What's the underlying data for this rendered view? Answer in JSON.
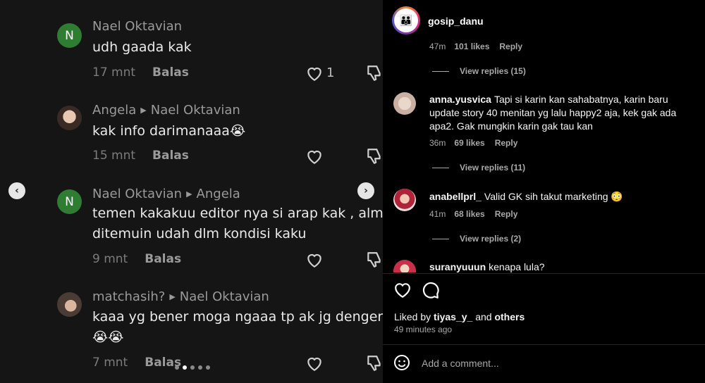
{
  "left": {
    "comments": [
      {
        "avatar_letter": "N",
        "author": "Nael Oktavian",
        "reply_to": "",
        "text": "udh gaada kak",
        "text2": "",
        "time": "17 mnt",
        "reply_label": "Balas",
        "likes": "1"
      },
      {
        "avatar_letter": "",
        "author": "Angela",
        "reply_to": "Nael Oktavian",
        "text": "kak info darimanaaa😭",
        "text2": "",
        "time": "15 mnt",
        "reply_label": "Balas",
        "likes": ""
      },
      {
        "avatar_letter": "N",
        "author": "Nael Oktavian",
        "reply_to": "Angela",
        "text": "temen kakakuu editor nya si arap kak , alm.",
        "text2": "ditemuin udah dlm kondisi kaku",
        "time": "9 mnt",
        "reply_label": "Balas",
        "likes": ""
      },
      {
        "avatar_letter": "",
        "author": "matchasih?",
        "reply_to": "Nael Oktavian",
        "text": "kaaa yg bener moga ngaaa tp ak jg dengerr",
        "text2": "😭😭",
        "time": "7 mnt",
        "reply_label": "Balas",
        "likes": ""
      }
    ],
    "nav_prev": "‹",
    "nav_next": "›"
  },
  "right": {
    "top_user": {
      "username": "gosip_danu",
      "time": "47m",
      "likes": "101 likes",
      "reply": "Reply",
      "view_replies": "View replies (15)"
    },
    "comments": [
      {
        "username": "anna.yusvica",
        "text": "Tapi si karin kan sahabatnya, karin baru update story 40 menitan yg lalu happy2 aja, kek gak ada apa2. Gak mungkin karin gak tau kan",
        "time": "36m",
        "likes": "69 likes",
        "reply": "Reply",
        "view_replies": "View replies (11)"
      },
      {
        "username": "anabellprl_",
        "text": "Valid GK sih takut marketing 😳",
        "time": "41m",
        "likes": "68 likes",
        "reply": "Reply",
        "view_replies": "View replies (2)"
      },
      {
        "username": "suranyuuun",
        "text": "kenapa lula?",
        "time": "",
        "likes": "",
        "reply": "",
        "view_replies": ""
      }
    ],
    "liked_by_prefix": "Liked by",
    "liked_by_user": "tiyas_y_",
    "liked_by_and": "and",
    "liked_by_others": "others",
    "time_ago": "49 minutes ago",
    "add_comment_placeholder": "Add a comment..."
  }
}
